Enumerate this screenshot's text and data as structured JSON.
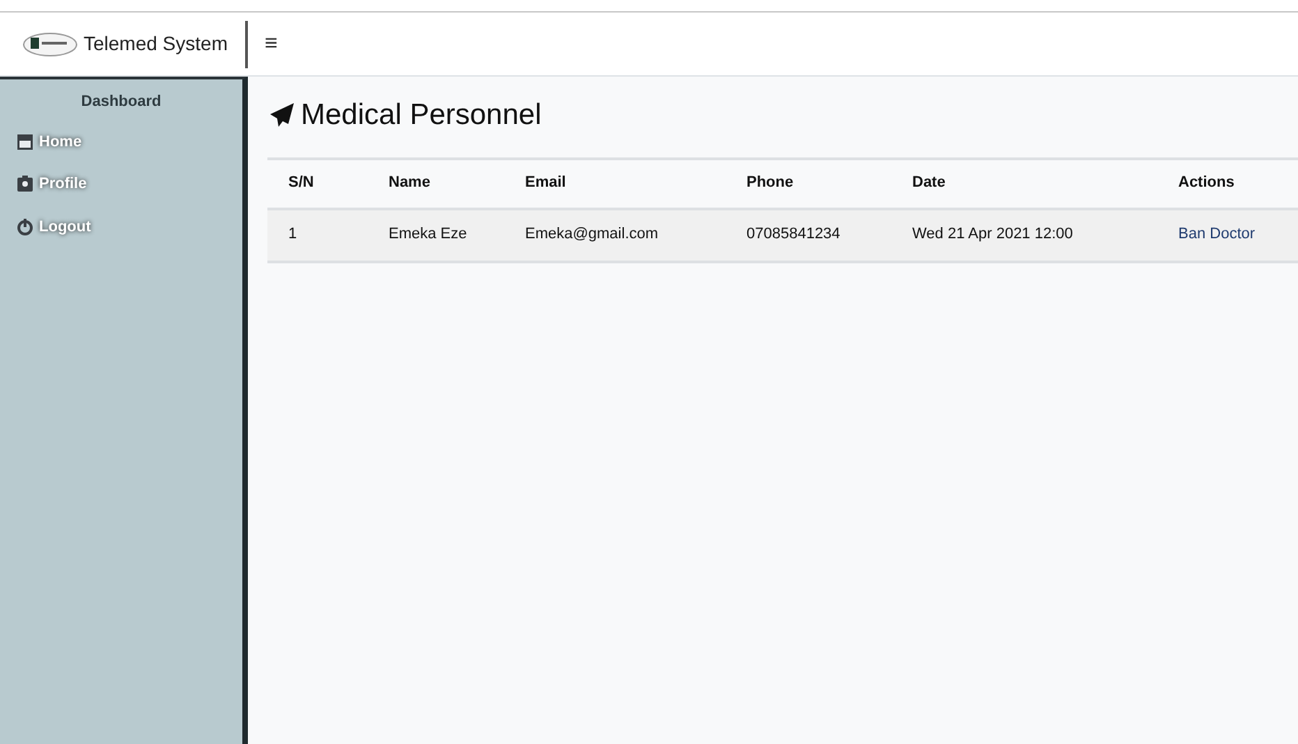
{
  "header": {
    "brand": "Telemed System",
    "menu_toggle": "≡"
  },
  "sidebar": {
    "title": "Dashboard",
    "items": [
      {
        "label": "Home",
        "kind": "home"
      },
      {
        "label": "Profile",
        "kind": "profile"
      },
      {
        "label": "Logout",
        "kind": "logout"
      }
    ]
  },
  "page": {
    "title": "Medical Personnel"
  },
  "table": {
    "columns": [
      "S/N",
      "Name",
      "Email",
      "Phone",
      "Date",
      "Actions"
    ],
    "rows": [
      {
        "cells": [
          "1",
          "Emeka Eze",
          "Emeka@gmail.com",
          "07085841234",
          "Wed 21 Apr 2021 12:00"
        ],
        "action": "Ban Doctor"
      }
    ]
  }
}
